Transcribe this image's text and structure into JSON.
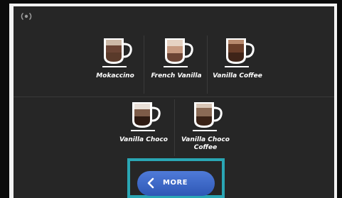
{
  "drinks_row1": [
    {
      "label": "Mokaccino",
      "layers": [
        "#5a3a2a",
        "#6b4434"
      ],
      "foam": "#cdb9a7"
    },
    {
      "label": "French Vanilla",
      "layers": [
        "#6b4434",
        "#c79a80"
      ],
      "foam": "#e6d3c3"
    },
    {
      "label": "Vanilla Coffee",
      "layers": [
        "#3f2418",
        "#6a3e29"
      ],
      "foam": "#b88a6e"
    }
  ],
  "drinks_row2": [
    {
      "label": "Vanilla Choco",
      "layers": [
        "#2e1a12",
        "#7d5b48"
      ],
      "foam": "#e9e0d8"
    },
    {
      "label": "Vanilla Choco Coffee",
      "layers": [
        "#3a2216",
        "#8a6a55"
      ],
      "foam": "#d8c6b6"
    }
  ],
  "more_button": {
    "label": "MORE",
    "icon": "chevron-left-icon"
  },
  "status": {
    "icon": "wifi-icon"
  },
  "colors": {
    "screen_bg": "#262626",
    "button": "#3c68c8",
    "highlight": "#2aa6b4"
  }
}
